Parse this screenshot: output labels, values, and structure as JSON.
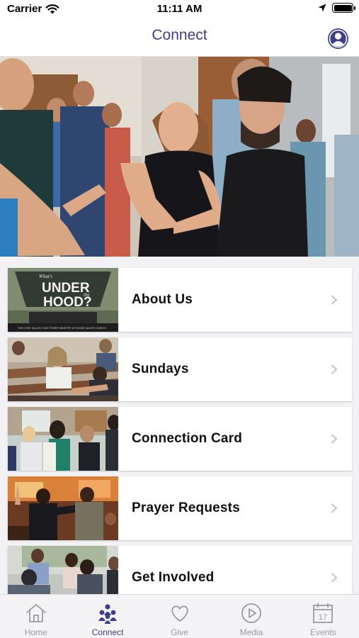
{
  "status_bar": {
    "carrier": "Carrier",
    "time": "11:11 AM"
  },
  "nav": {
    "title": "Connect"
  },
  "menu": {
    "items": [
      {
        "label": "About Us",
        "thumb_text_1": "UNDER",
        "thumb_text_2": "HOOD?",
        "thumb_small_1": "What's",
        "thumb_small_2": "the",
        "thumb_caption": "THE CORE VALUES THAT POWER MINISTRY AT DIVINE SAVIOR CHURCH"
      },
      {
        "label": "Sundays"
      },
      {
        "label": "Connection Card"
      },
      {
        "label": "Prayer Requests"
      },
      {
        "label": "Get Involved"
      }
    ]
  },
  "tab_bar": {
    "tabs": [
      {
        "label": "Home"
      },
      {
        "label": "Connect"
      },
      {
        "label": "Give"
      },
      {
        "label": "Media"
      },
      {
        "label": "Events",
        "calendar_day": "17"
      }
    ]
  },
  "colors": {
    "accent": "#3d3f8c",
    "inactive": "#9a9aa2"
  }
}
